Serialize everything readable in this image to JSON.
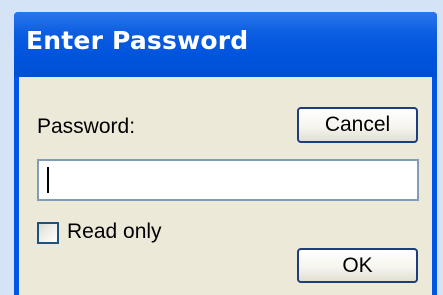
{
  "window": {
    "title": "Enter Password"
  },
  "form": {
    "password_label": "Password:",
    "password_value": "",
    "read_only_label": "Read only",
    "read_only_checked": false
  },
  "buttons": {
    "cancel_label": "Cancel",
    "ok_label": "OK"
  },
  "colors": {
    "titlebar": "#0053dc",
    "title_text": "#ffffff",
    "client_bg": "#ece9d8",
    "page_bg": "#d4e4f6",
    "field_border": "#7f9db9",
    "button_border": "#1f3d7a"
  }
}
